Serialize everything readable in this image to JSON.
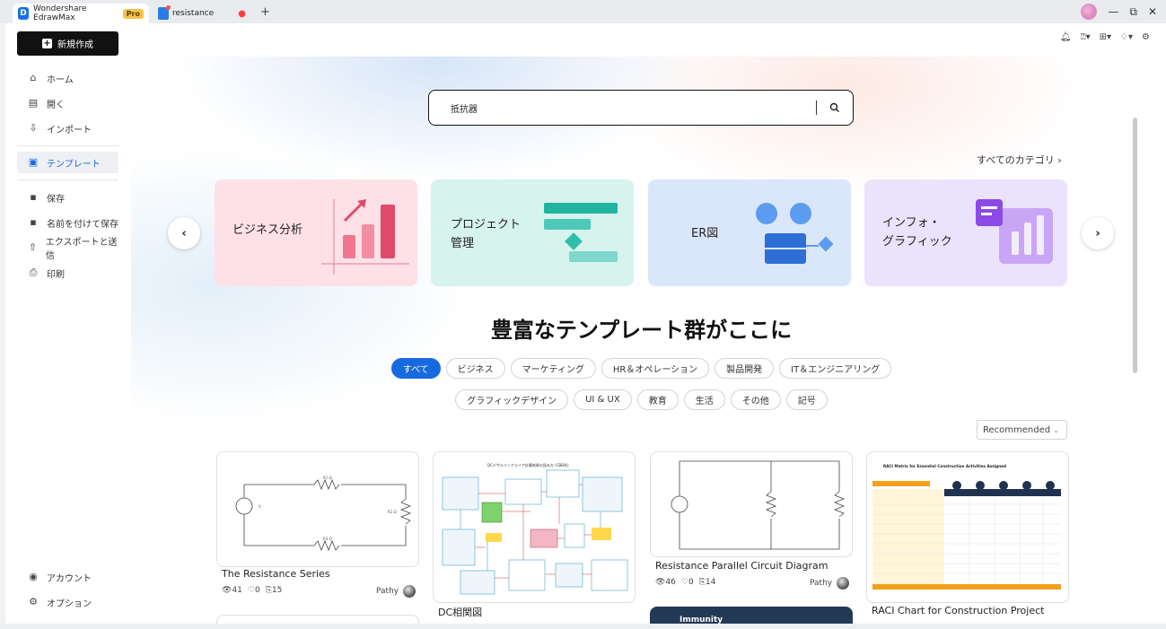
{
  "titlebar": {
    "app_tab": "Wondershare EdrawMax",
    "pro_badge": "Pro",
    "doc_tab": "resistance",
    "unsaved_dot": "●",
    "new_tab": "+",
    "minimize": "—",
    "restore": "⧉",
    "close": "✕"
  },
  "sidebar": {
    "new_button": "新規作成",
    "items": [
      {
        "label": "ホーム",
        "icon": "home-icon"
      },
      {
        "label": "開く",
        "icon": "open-icon"
      },
      {
        "label": "インポート",
        "icon": "import-icon"
      },
      {
        "label": "テンプレート",
        "icon": "template-icon"
      },
      {
        "label": "保存",
        "icon": "save-icon"
      },
      {
        "label": "名前を付けて保存",
        "icon": "save-as-icon"
      },
      {
        "label": "エクスポートと送信",
        "icon": "export-icon"
      },
      {
        "label": "印刷",
        "icon": "print-icon"
      }
    ],
    "bottom": [
      {
        "label": "アカウント",
        "icon": "account-icon"
      },
      {
        "label": "オプション",
        "icon": "options-icon"
      }
    ]
  },
  "search": {
    "value": "抵抗器"
  },
  "all_categories": "すべてのカテゴリ ›",
  "categories": [
    {
      "label_1": "ビジネス分析",
      "label_2": "",
      "color": "#fde0e6"
    },
    {
      "label_1": "プロジェクト",
      "label_2": "管理",
      "color": "#d7f3ee"
    },
    {
      "label_1": "ER図",
      "label_2": "",
      "color": "#dbe8fb"
    },
    {
      "label_1": "インフォ・",
      "label_2": "グラフィック",
      "color": "#ece3fb"
    }
  ],
  "headline": "豊富なテンプレート群がここに",
  "filters_row1": [
    "すべて",
    "ビジネス",
    "マーケティング",
    "HR＆オペレーション",
    "製品開発",
    "IT＆エンジニアリング"
  ],
  "filters_row2": [
    "グラフィックデザイン",
    "UI & UX",
    "教育",
    "生活",
    "その他",
    "記号"
  ],
  "sort": {
    "selected": "Recommended"
  },
  "templates": [
    {
      "name": "The Resistance Series",
      "views": "41",
      "likes": "0",
      "copies": "15",
      "author": "Pathy"
    },
    {
      "name": "DC相関図",
      "views": "",
      "likes": "",
      "copies": "",
      "author": ""
    },
    {
      "name": "Resistance Parallel Circuit Diagram",
      "views": "46",
      "likes": "0",
      "copies": "14",
      "author": "Pathy"
    },
    {
      "name": "RACI Chart for Construction Project",
      "views": "",
      "likes": "",
      "copies": "",
      "author": ""
    }
  ],
  "partial_card_title": "Immunity",
  "thumb_text": {
    "dc_title": "DCデザルインクライア計算結果の読み方 (CBB系)",
    "raci_title": "RACI Matrix for Essential Construction Activities Assigned",
    "res_labels": [
      "R1 Ω",
      "R2 Ω",
      "R3 Ω",
      "V"
    ]
  }
}
